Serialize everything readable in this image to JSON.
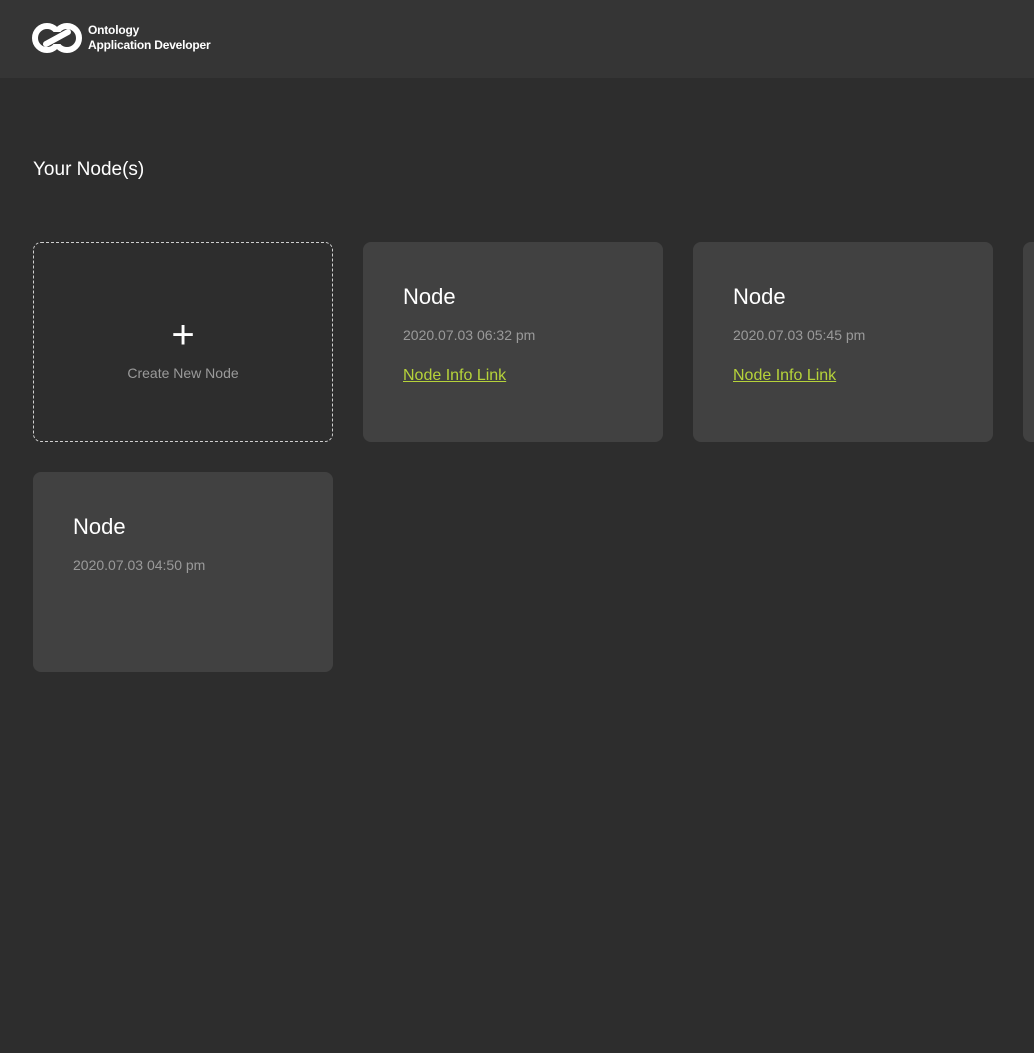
{
  "header": {
    "brand_line1": "Ontology",
    "brand_line2": "Application Developer"
  },
  "main": {
    "title": "Your Node(s)",
    "create_card": {
      "plus": "+",
      "label": "Create New Node"
    },
    "nodes": [
      {
        "title": "Node",
        "date": "2020.07.03 06:32 pm",
        "link": "Node Info Link"
      },
      {
        "title": "Node",
        "date": "2020.07.03 05:45 pm",
        "link": "Node Info Link"
      },
      {
        "title": "Node",
        "date": "2020.07.03 04:50 pm",
        "link": ""
      }
    ]
  },
  "colors": {
    "background": "#2d2d2d",
    "header": "#353535",
    "card": "#414141",
    "link": "#b6d33a"
  }
}
